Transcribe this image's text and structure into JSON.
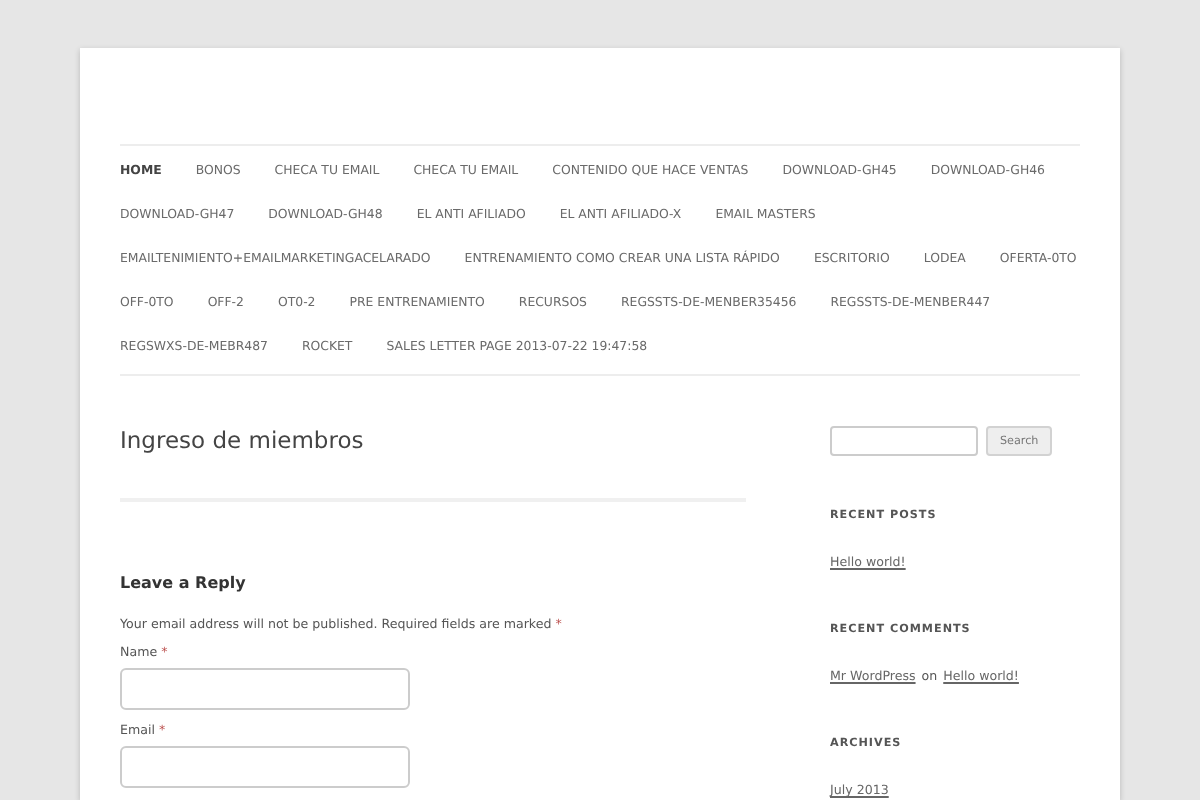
{
  "nav": [
    {
      "label": "HOME",
      "selected": true
    },
    {
      "label": "BONOS",
      "selected": false
    },
    {
      "label": "CHECA TU EMAIL",
      "selected": false
    },
    {
      "label": "CHECA TU EMAIL",
      "selected": false
    },
    {
      "label": "CONTENIDO QUE HACE VENTAS",
      "selected": false
    },
    {
      "label": "DOWNLOAD-GH45",
      "selected": false
    },
    {
      "label": "DOWNLOAD-GH46",
      "selected": false
    },
    {
      "label": "DOWNLOAD-GH47",
      "selected": false
    },
    {
      "label": "DOWNLOAD-GH48",
      "selected": false
    },
    {
      "label": "EL ANTI AFILIADO",
      "selected": false
    },
    {
      "label": "EL ANTI AFILIADO-X",
      "selected": false
    },
    {
      "label": "EMAIL MASTERS",
      "selected": false
    },
    {
      "label": "EMAILTENIMIENTO+EMAILMARKETINGACELARADO",
      "selected": false
    },
    {
      "label": "ENTRENAMIENTO COMO CREAR UNA LISTA RÁPIDO",
      "selected": false
    },
    {
      "label": "ESCRITORIO",
      "selected": false
    },
    {
      "label": "LODEA",
      "selected": false
    },
    {
      "label": "OFERTA-0TO",
      "selected": false
    },
    {
      "label": "OFF-0TO",
      "selected": false
    },
    {
      "label": "OFF-2",
      "selected": false
    },
    {
      "label": "OT0-2",
      "selected": false
    },
    {
      "label": "PRE ENTRENAMIENTO",
      "selected": false
    },
    {
      "label": "RECURSOS",
      "selected": false
    },
    {
      "label": "REGSSTS-DE-MENBER35456",
      "selected": false
    },
    {
      "label": "REGSSTS-DE-MENBER447",
      "selected": false
    },
    {
      "label": "REGSWXS-DE-MEBR487",
      "selected": false
    },
    {
      "label": "ROCKET",
      "selected": false
    },
    {
      "label": "SALES LETTER PAGE 2013-07-22 19:47:58",
      "selected": false
    }
  ],
  "page_title": "Ingreso de miembros",
  "reply": {
    "heading": "Leave a Reply",
    "notice": "Your email address will not be published. Required fields are marked",
    "notice_mark": "*",
    "fields": [
      {
        "label": "Name",
        "mark": "*"
      },
      {
        "label": "Email",
        "mark": "*"
      }
    ]
  },
  "sidebar": {
    "search_button": "Search",
    "recent_posts": {
      "title": "RECENT POSTS",
      "items": [
        "Hello world!"
      ]
    },
    "recent_comments": {
      "title": "RECENT COMMENTS",
      "author": "Mr WordPress",
      "joiner": "on",
      "post": "Hello world!"
    },
    "archives": {
      "title": "ARCHIVES",
      "items": [
        "July 2013"
      ]
    }
  }
}
